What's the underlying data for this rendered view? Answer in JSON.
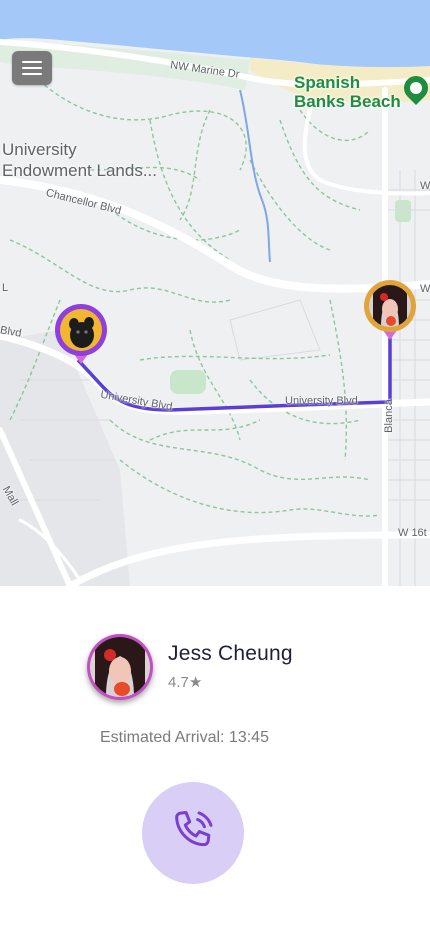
{
  "map": {
    "labels": {
      "area_line1": "University",
      "area_line2": "Endowment Lands...",
      "beach_line1": "Spanish",
      "beach_line2": "Banks Beach",
      "nw_marine": "NW Marine Dr",
      "chancellor": "Chancellor Blvd",
      "university_blvd_left": "University Blvd",
      "university_blvd_right": "University Blvd",
      "blanca": "Blanca",
      "w16": "W 16t",
      "w_top": "W",
      "w_mid": "W",
      "l_edge": "L",
      "blvd_edge": "Blvd",
      "mall": "Mall"
    },
    "menu_icon": "hamburger-menu-icon",
    "route_color": "#5a3fd6",
    "pin_color": "#8e3fe0"
  },
  "driver": {
    "name": "Jess Cheung",
    "rating": "4.7★",
    "eta": "Estimated Arrival: 13:45"
  },
  "call": {
    "icon": "phone-ringing-icon",
    "color": "#d9cff6"
  }
}
